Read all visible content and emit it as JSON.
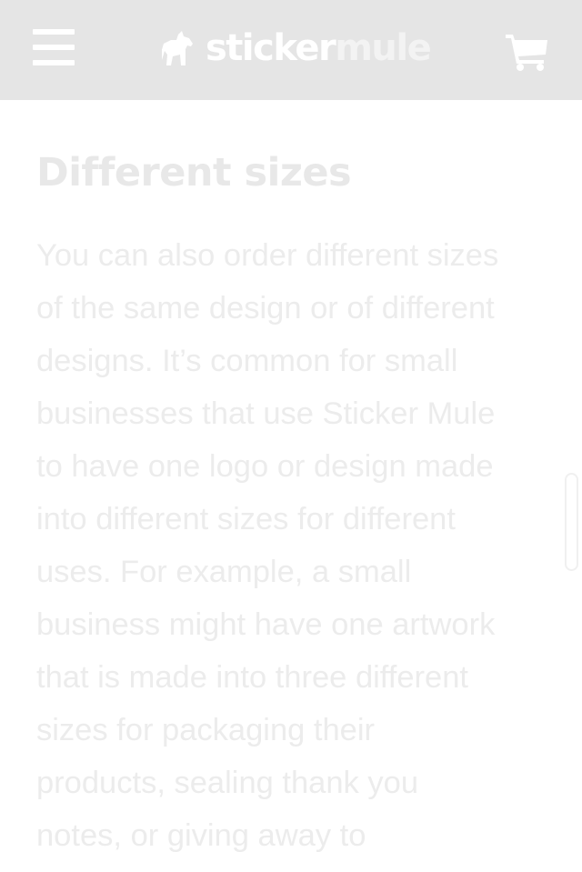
{
  "header": {
    "menu_icon": "hamburger-menu-icon",
    "logo": {
      "part1": "sticker",
      "part2": "mule",
      "icon": "mule-icon"
    },
    "cart_icon": "shopping-cart-icon",
    "background": "#e5e5e5"
  },
  "article": {
    "heading": "Different sizes",
    "paragraph_lines": [
      "You can also order different sizes",
      "of the same design or of different",
      "designs. It’s common for small",
      "businesses that use Sticker Mule",
      "to have one logo or design made",
      "into different sizes for different",
      "uses. For example, a small",
      "business might have one artwork",
      "that is made into three different",
      "sizes for packaging their",
      "products, sealing thank you",
      "notes, or giving away to"
    ]
  },
  "colors": {
    "heading": "#e8e8e8",
    "text": "#ececec",
    "header_icons": "#ffffff"
  }
}
